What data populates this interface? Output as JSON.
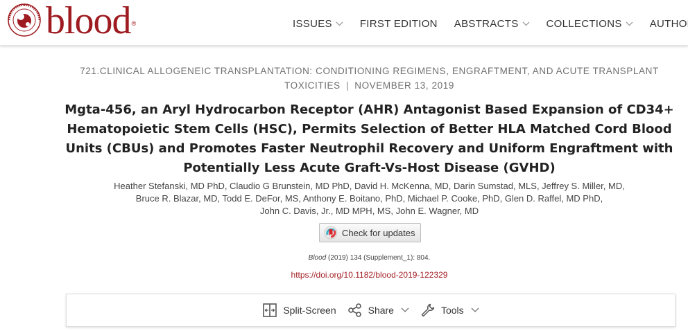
{
  "header": {
    "brand": "blood",
    "registered_mark": "®",
    "brand_color": "#9e1b21",
    "nav": [
      {
        "label": "ISSUES",
        "has_dropdown": true
      },
      {
        "label": "FIRST EDITION",
        "has_dropdown": false
      },
      {
        "label": "ABSTRACTS",
        "has_dropdown": true
      },
      {
        "label": "COLLECTIONS",
        "has_dropdown": true
      },
      {
        "label": "AUTHORS",
        "has_dropdown": true
      }
    ]
  },
  "article": {
    "category": "721.CLINICAL ALLOGENEIC TRANSPLANTATION: CONDITIONING REGIMENS, ENGRAFTMENT, AND ACUTE TRANSPLANT TOXICITIES",
    "separator": "|",
    "date": "NOVEMBER 13, 2019",
    "title": "Mgta-456, an Aryl Hydrocarbon Receptor (AHR) Antagonist Based Expansion of CD34+ Hematopoietic Stem Cells (HSC), Permits Selection of Better HLA Matched Cord Blood Units (CBUs) and Promotes Faster Neutrophil Recovery and Uniform Engraftment with Potentially Less Acute Graft-Vs-Host Disease (GVHD)",
    "authors_lines": [
      "Heather Stefanski, MD PhD, Claudio G Brunstein, MD PhD, David H. McKenna, MD, Darin Sumstad, MLS, Jeffrey S. Miller, MD,",
      "Bruce R. Blazar, MD, Todd E. DeFor, MS, Anthony E. Boitano, PhD, Michael P. Cooke, PhD, Glen D. Raffel, MD PhD,",
      "John C. Davis, Jr., MD MPH, MS, John E. Wagner, MD"
    ],
    "check_updates_label": "Check for updates",
    "citation_journal": "Blood",
    "citation_rest": " (2019) 134 (Supplement_1): 804.",
    "doi": "https://doi.org/10.1182/blood-2019-122329",
    "doi_color": "#a31f24"
  },
  "toolbar": {
    "split_screen": "Split-Screen",
    "share": "Share",
    "tools": "Tools"
  }
}
